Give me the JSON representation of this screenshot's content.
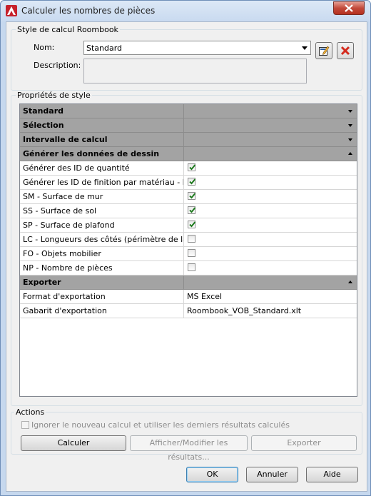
{
  "window": {
    "title": "Calculer les nombres de pièces"
  },
  "style_group": {
    "label": "Style de calcul Roombook",
    "name_label": "Nom:",
    "name_value": "Standard",
    "description_label": "Description:",
    "description_value": ""
  },
  "props_group": {
    "label": "Propriétés de style"
  },
  "grid": {
    "categories": {
      "standard": "Standard",
      "selection": "Sélection",
      "intervalle": "Intervalle de calcul",
      "generer": "Générer les données de dessin",
      "exporter": "Exporter"
    },
    "rows": [
      {
        "label": "Générer des ID de quantité",
        "checked": true
      },
      {
        "label": "Générer les ID de finition par matériau - Nc",
        "checked": true
      },
      {
        "label": "SM - Surface de mur",
        "checked": true
      },
      {
        "label": "SS - Surface de sol",
        "checked": true
      },
      {
        "label": "SP - Surface de plafond",
        "checked": true
      },
      {
        "label": "LC - Longueurs des côtés (périmètre de la p",
        "checked": false
      },
      {
        "label": "FO - Objets mobilier",
        "checked": false
      },
      {
        "label": "NP - Nombre de pièces",
        "checked": false
      }
    ],
    "export_rows": [
      {
        "label": "Format d'exportation",
        "value": "MS Excel"
      },
      {
        "label": "Gabarit d'exportation",
        "value": "Roombook_VOB_Standard.xlt"
      }
    ]
  },
  "actions": {
    "label": "Actions",
    "ignore_label": "Ignorer le nouveau calcul et utiliser les derniers résultats calculés",
    "calculer": "Calculer",
    "afficher": "Afficher/Modifier les résultats...",
    "exporter": "Exporter"
  },
  "footer": {
    "ok": "OK",
    "annuler": "Annuler",
    "aide": "Aide"
  },
  "colors": {
    "check": "#1e7a1e",
    "category_bg": "#a3a3a3",
    "delete_red": "#d42a1c"
  }
}
